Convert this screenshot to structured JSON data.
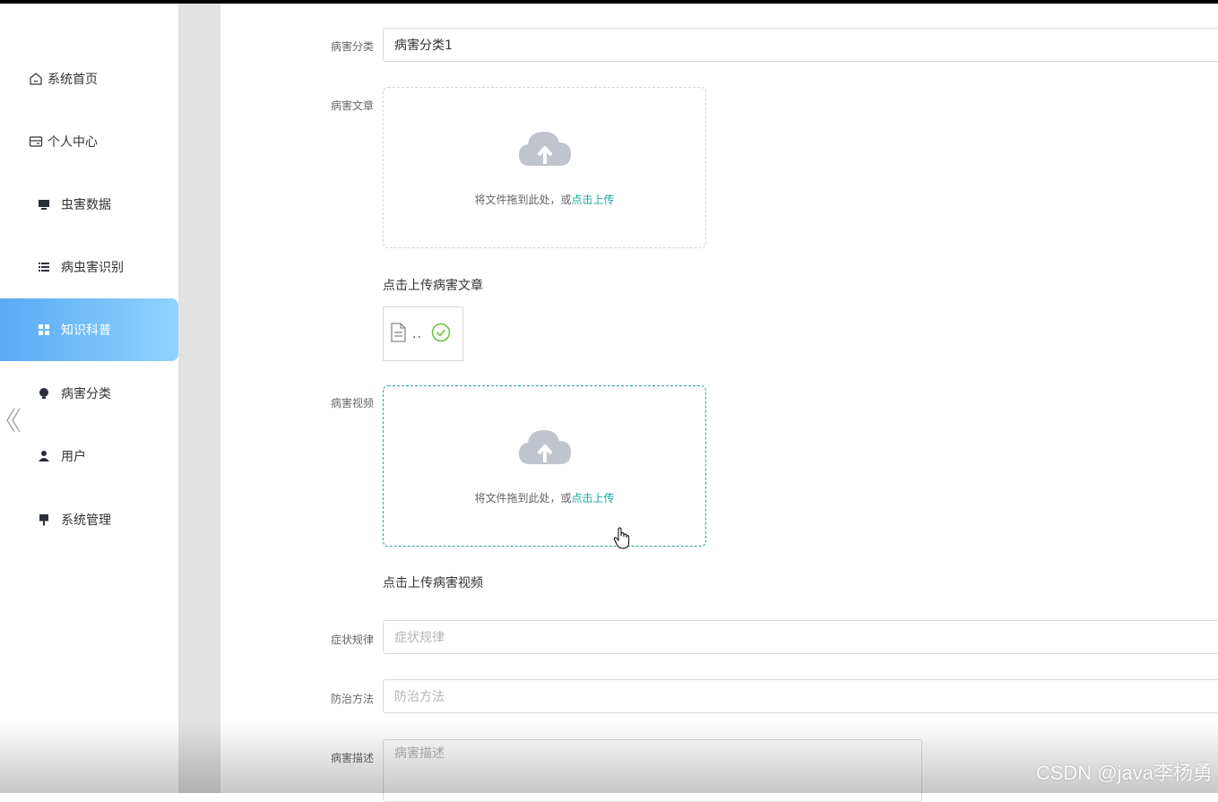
{
  "sidebar": {
    "items": [
      {
        "label": "系统首页",
        "icon": "home-icon"
      },
      {
        "label": "个人中心",
        "icon": "id-card-icon"
      },
      {
        "label": "虫害数据",
        "icon": "monitor-icon"
      },
      {
        "label": "病虫害识别",
        "icon": "list-icon"
      },
      {
        "label": "知识科普",
        "icon": "grid-icon",
        "active": true
      },
      {
        "label": "病害分类",
        "icon": "bulb-icon"
      },
      {
        "label": "用户",
        "icon": "user-icon"
      },
      {
        "label": "系统管理",
        "icon": "brush-icon"
      }
    ]
  },
  "form": {
    "category": {
      "label": "病害分类",
      "value": "病害分类1"
    },
    "article": {
      "label": "病害文章",
      "drop_text": "将文件拖到此处，或",
      "link_text": "点击上传",
      "tip": "点击上传病害文章",
      "file_name": ".."
    },
    "video": {
      "label": "病害视频",
      "drop_text": "将文件拖到此处，或",
      "link_text": "点击上传",
      "tip": "点击上传病害视频"
    },
    "symptom": {
      "label": "症状规律",
      "placeholder": "症状规律"
    },
    "prevention": {
      "label": "防治方法",
      "placeholder": "防治方法"
    },
    "description": {
      "label": "病害描述",
      "placeholder": "病害描述"
    }
  },
  "colors": {
    "accent": "#14a89b",
    "active_gradient_start": "#5aaaf4",
    "active_gradient_end": "#8ed4ff",
    "success": "#67c23a"
  },
  "watermark": "CSDN @java李杨勇"
}
